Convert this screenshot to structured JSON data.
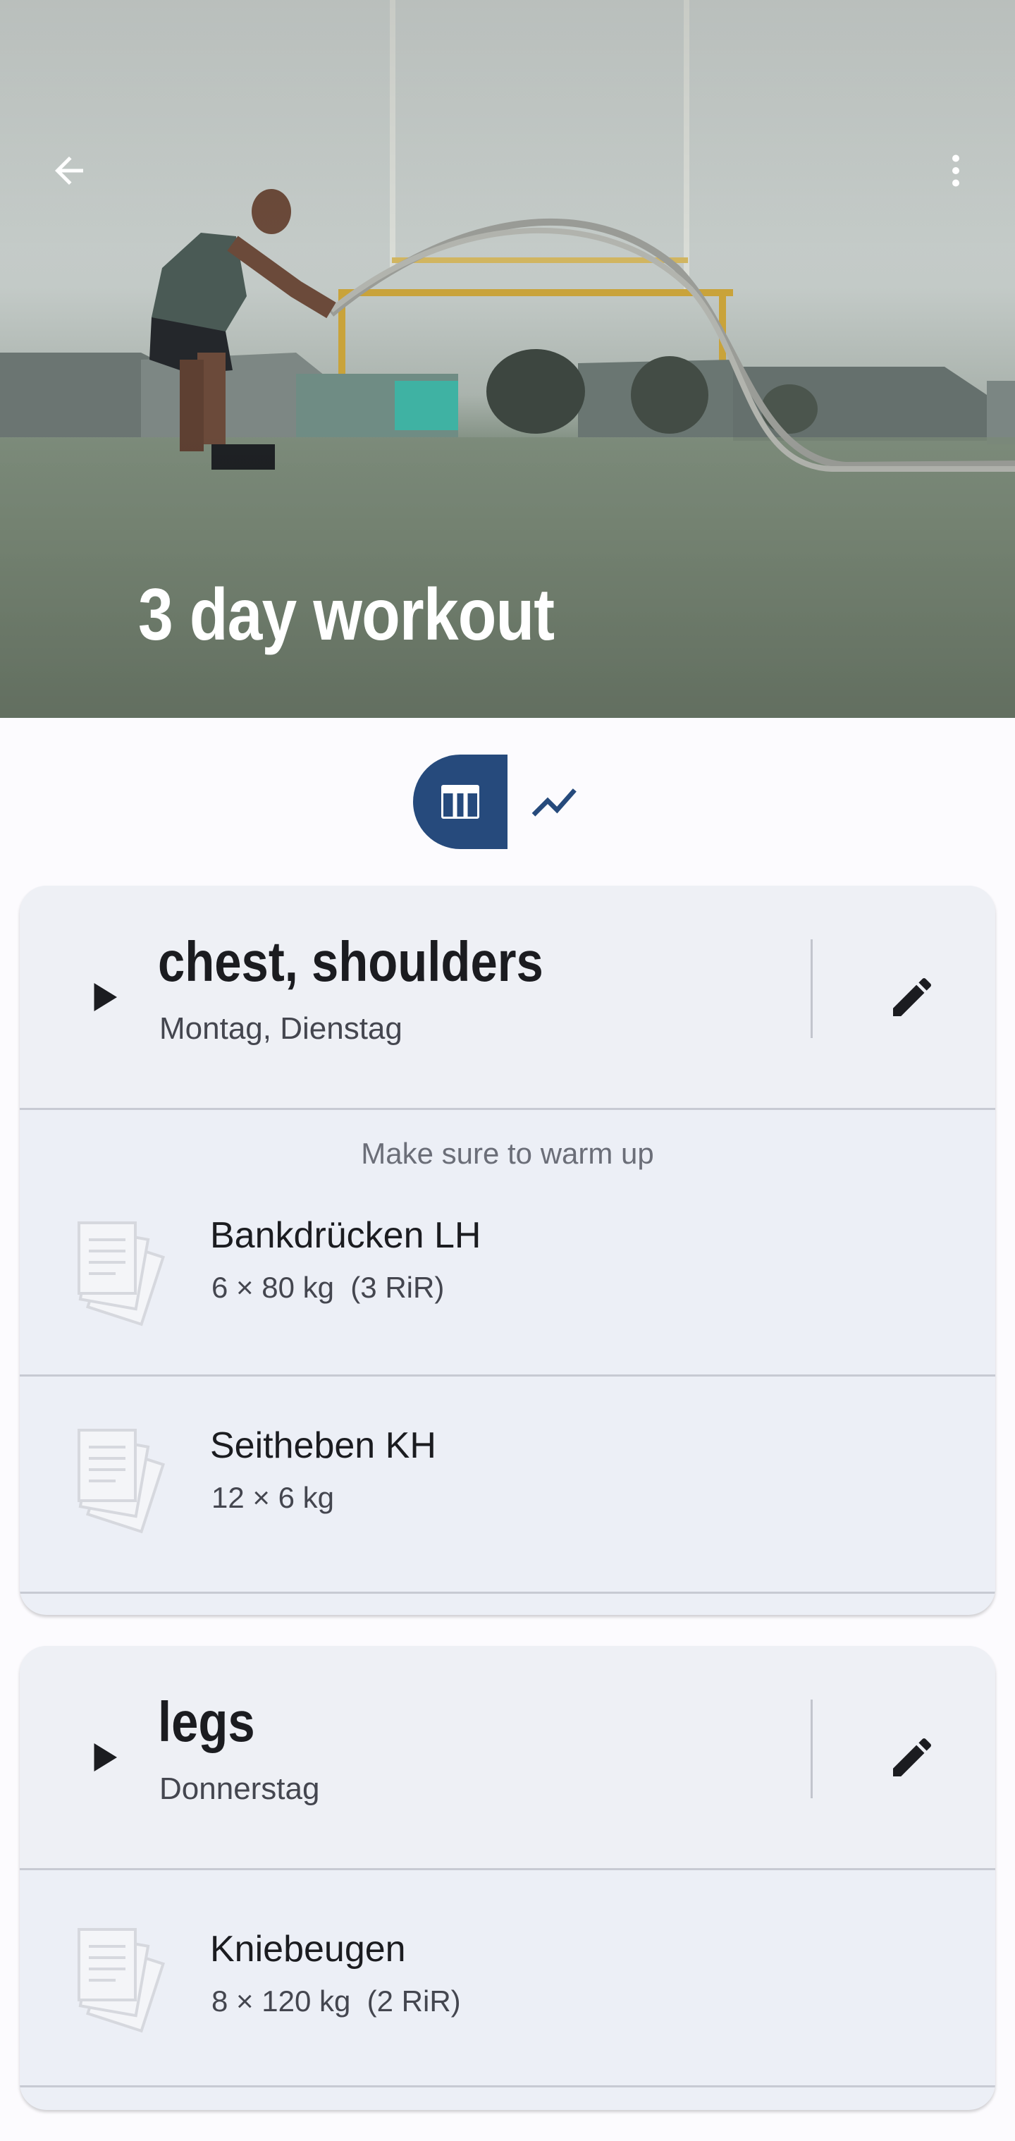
{
  "header": {
    "title": "3 day workout",
    "back_icon": "arrow-back-icon",
    "menu_icon": "more-vert-icon"
  },
  "view_toggle": {
    "options": [
      {
        "icon": "table-icon",
        "selected": true
      },
      {
        "icon": "trending-up-icon",
        "selected": false
      }
    ]
  },
  "colors": {
    "accent": "#264a7c",
    "card_bg": "#eceff6",
    "page_bg": "#fcfbfe"
  },
  "days": [
    {
      "title": "chest, shoulders",
      "subtitle": "Montag, Dienstag",
      "note": "Make sure to warm up",
      "exercises": [
        {
          "name": "Bankdrücken LH",
          "detail": "6 × 80 kg  (3 RiR)"
        },
        {
          "name": "Seitheben KH",
          "detail": "12 × 6 kg"
        }
      ]
    },
    {
      "title": "legs",
      "subtitle": "Donnerstag",
      "note": "",
      "exercises": [
        {
          "name": "Kniebeugen",
          "detail": "8 × 120 kg  (2 RiR)"
        }
      ]
    }
  ]
}
